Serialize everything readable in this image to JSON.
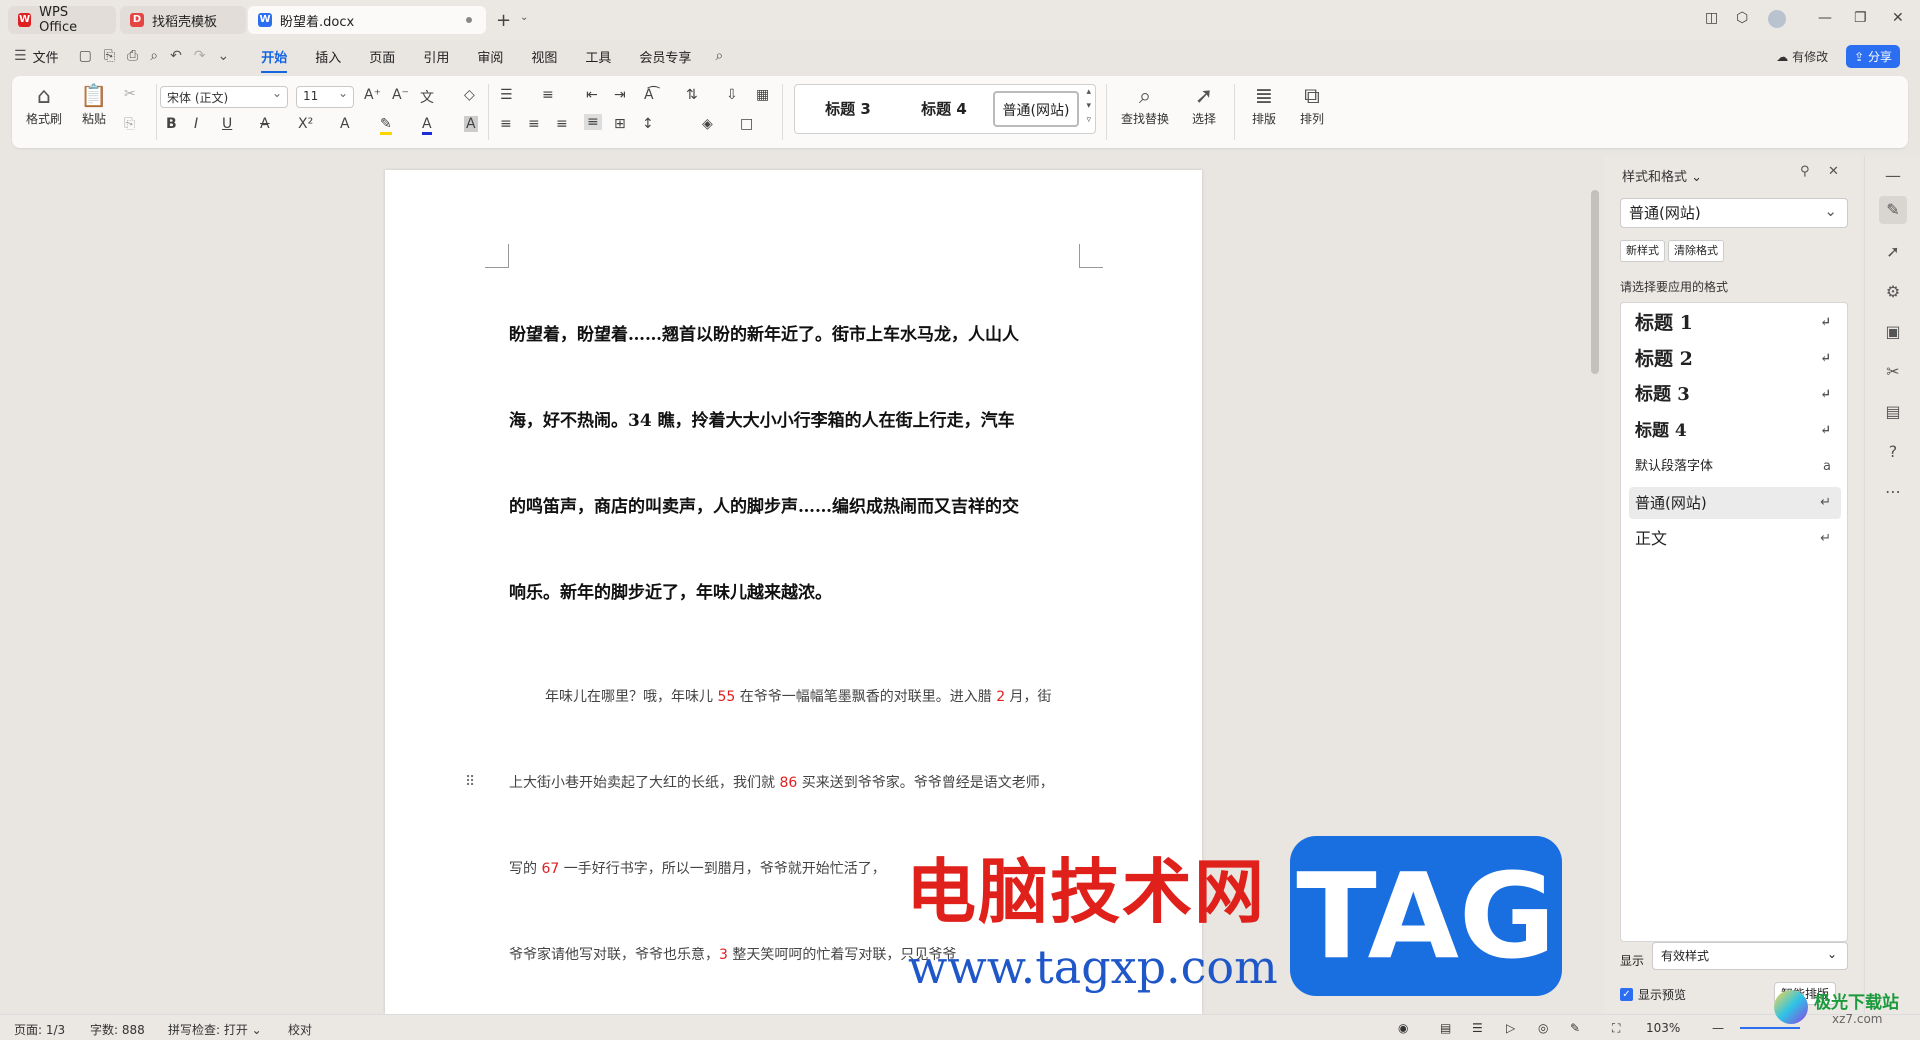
{
  "tabs": [
    {
      "label": "WPS Office",
      "icon": "wps-logo-icon",
      "color": "#e02020"
    },
    {
      "label": "找稻壳模板",
      "icon": "docer-icon",
      "color": "#e84343"
    },
    {
      "label": "盼望着.docx",
      "icon": "word-doc-icon",
      "color": "#2b6ef2"
    }
  ],
  "menu": {
    "file": "文件",
    "items": [
      "开始",
      "插入",
      "页面",
      "引用",
      "审阅",
      "视图",
      "工具",
      "会员专享"
    ],
    "active": "开始"
  },
  "header_right": {
    "modified": "有修改",
    "share": "分享"
  },
  "ribbon": {
    "format_painter": "格式刷",
    "paste": "粘贴",
    "font_name": "宋体 (正文)",
    "font_size": "11",
    "styles": [
      "标题 3",
      "标题 4",
      "普通(网站)"
    ],
    "find_replace": "查找替换",
    "select": "选择",
    "typeset": "排版",
    "arrange": "排列"
  },
  "document": {
    "bold_lines": [
      "盼望着，盼望着……翘首以盼的新年近了。街市上车水马龙，人山人",
      "海，好不热闹。34 瞧，拎着大大小小行李箱的人在街上行走，汽车",
      "的鸣笛声，商店的叫卖声，人的脚步声……编织成热闹而又吉祥的交",
      "响乐。新年的脚步近了，年味儿越来越浓。"
    ],
    "para_line1": {
      "a": "年味儿在哪里？哦，年味儿 ",
      "n1": "55",
      "b": " 在爷爷一幅幅笔墨飘香的对联里。进入腊 ",
      "n2": "2",
      "c": " 月，街"
    },
    "para_line2": {
      "a": "上大街小巷开始卖起了大红的长纸，我们就 ",
      "n1": "86",
      "b": " 买来送到爷爷家。爷爷曾经是语文老师，"
    },
    "para_line3": {
      "a": "写的 ",
      "n1": "67",
      "b": " 一手好行书字，所以一到腊月，爷爷就开始忙活了，"
    },
    "para_line4": {
      "a": "爷爷家请他写对联，爷爷也乐意，",
      "n1": "3",
      "b": " 整天笑呵呵的忙着写对联，只见爷爷"
    }
  },
  "watermark": {
    "cn": "电脑技术网",
    "url": "www.tagxp.com",
    "tag": "TAG"
  },
  "panel": {
    "title": "样式和格式",
    "current_style": "普通(网站)",
    "new_style": "新样式",
    "clear_format": "清除格式",
    "hint": "请选择要应用的格式",
    "styles": [
      {
        "label": "标题 1",
        "kind": "heading"
      },
      {
        "label": "标题 2",
        "kind": "heading"
      },
      {
        "label": "标题 3",
        "kind": "heading"
      },
      {
        "label": "标题 4",
        "kind": "heading"
      },
      {
        "label": "默认段落字体",
        "kind": "char"
      },
      {
        "label": "普通(网站)",
        "kind": "normal",
        "selected": true
      },
      {
        "label": "正文",
        "kind": "normal"
      }
    ],
    "show_label": "显示",
    "show_value": "有效样式",
    "preview_label": "显示预览",
    "smart_typeset": "智能排版"
  },
  "statusbar": {
    "page": "页面: 1/3",
    "words": "字数: 888",
    "spell": "拼写检查: 打开",
    "proof": "校对",
    "zoom": "103%"
  },
  "brand": {
    "text": "极光下载站",
    "sub": "xz7.com"
  },
  "colors": {
    "accent": "#1665e0",
    "share": "#2b6ef2",
    "red_number": "#e02020"
  }
}
